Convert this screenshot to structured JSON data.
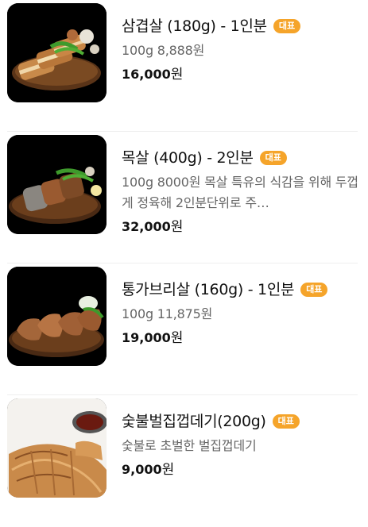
{
  "menu": {
    "items": [
      {
        "name": "삼겹살 (180g) - 1인분",
        "badge": "대표",
        "description": "100g 8,888원",
        "price": "16,000",
        "currency": "원",
        "image_icon": "grilled-pork-belly-image"
      },
      {
        "name": "목살 (400g) - 2인분",
        "badge": "대표",
        "description": "100g 8000원 목살 특유의 식감을 위해 두껍게 정육해 2인분단위로 주…",
        "price": "32,000",
        "currency": "원",
        "image_icon": "grilled-pork-neck-image"
      },
      {
        "name": "통가브리살 (160g) - 1인분",
        "badge": "대표",
        "description": "100g 11,875원",
        "price": "19,000",
        "currency": "원",
        "image_icon": "grilled-pork-jowl-image"
      },
      {
        "name": "숯불벌집껍데기(200g)",
        "badge": "대표",
        "description": "숯불로 초벌한 벌집껍데기",
        "price": "9,000",
        "currency": "원",
        "image_icon": "grilled-pork-skin-image"
      }
    ]
  },
  "colors": {
    "badge": "#f5a42a",
    "divider": "#eeeeee",
    "text": "#111111",
    "muted": "#666666"
  }
}
